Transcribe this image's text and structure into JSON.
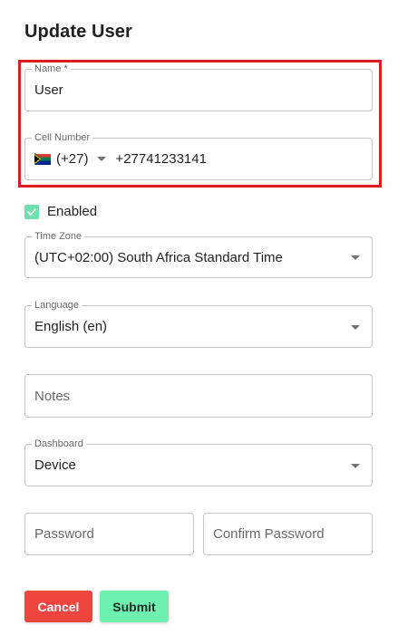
{
  "form": {
    "title": "Update User",
    "name": {
      "label": "Name *",
      "value": "User"
    },
    "cell_number": {
      "label": "Cell Number",
      "country_flag": "south-africa-flag",
      "country_code": "(+27)",
      "value": "+27741233141"
    },
    "enabled": {
      "label": "Enabled",
      "checked": true,
      "check_color": "#6fe0ad"
    },
    "time_zone": {
      "label": "Time Zone",
      "value": "(UTC+02:00) South Africa Standard Time"
    },
    "language": {
      "label": "Language",
      "value": "English (en)"
    },
    "notes": {
      "placeholder": "Notes"
    },
    "dashboard": {
      "label": "Dashboard",
      "value": "Device"
    },
    "password": {
      "placeholder": "Password"
    },
    "confirm_password": {
      "placeholder": "Confirm Password"
    }
  },
  "actions": {
    "cancel_label": "Cancel",
    "submit_label": "Submit",
    "cancel_color": "#f0453f",
    "submit_color": "#6ef0b1"
  },
  "highlight_color": "#e01b24"
}
